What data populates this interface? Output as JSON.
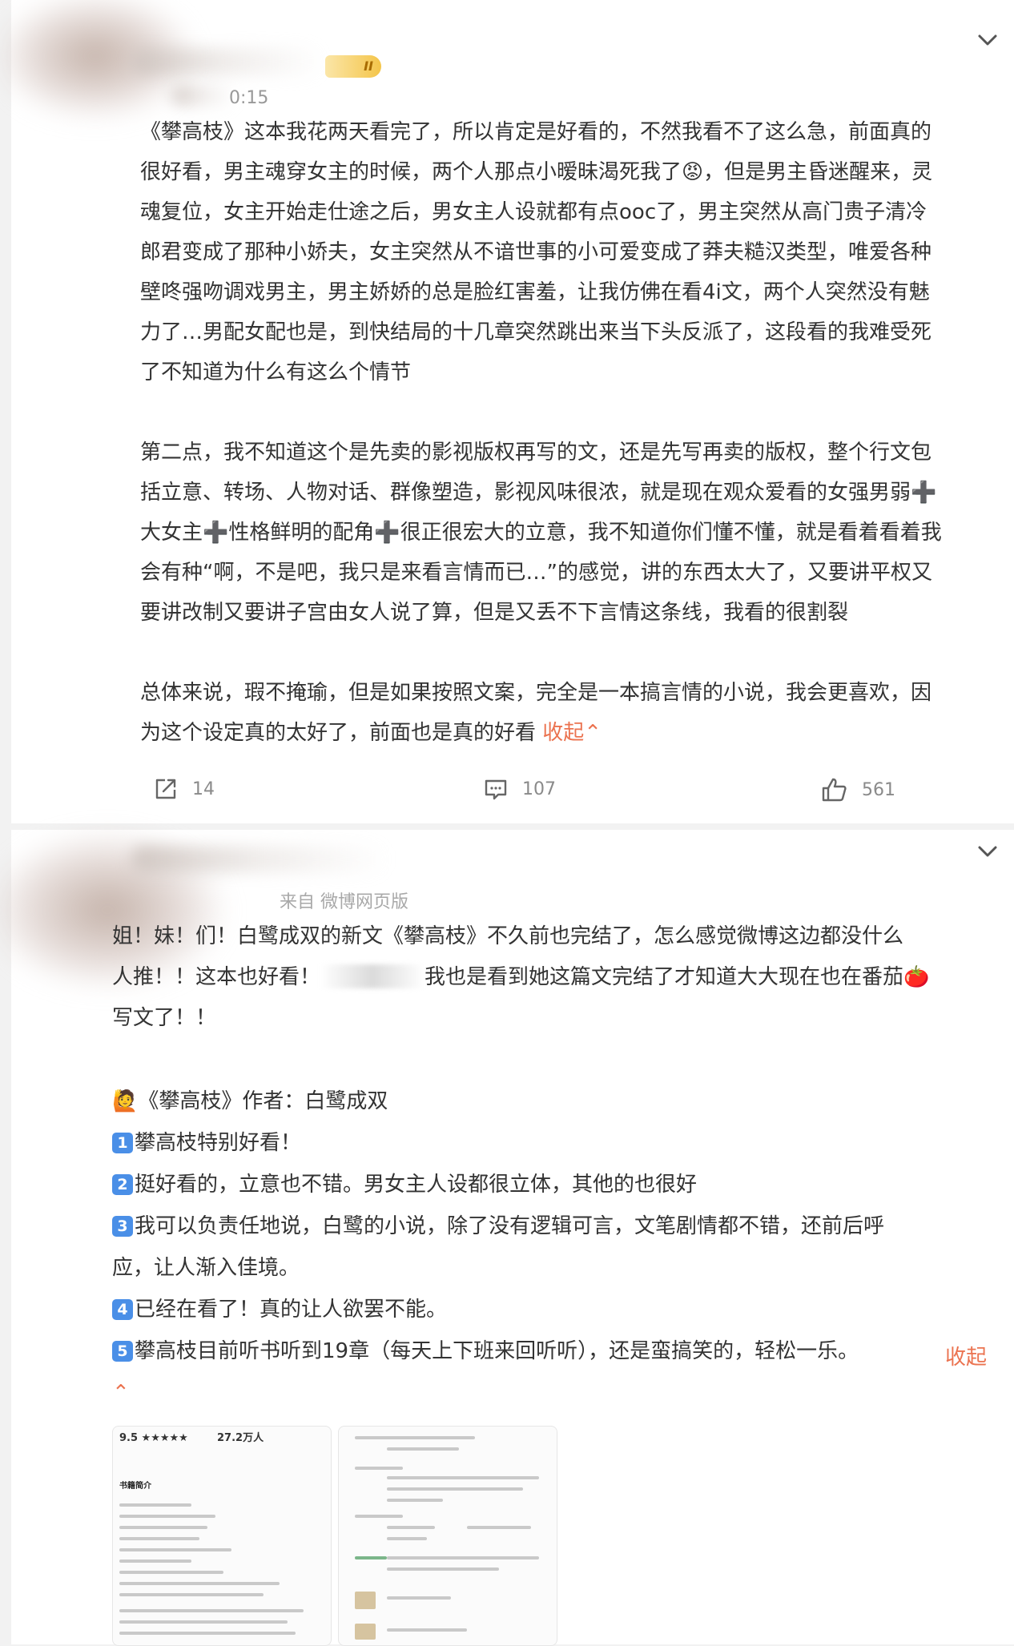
{
  "post1": {
    "time_suffix": "0:15",
    "badge_label": "II",
    "paragraphs": [
      [
        "《攀高枝》这本我花两天看完了，所以肯定是好看的，不然我看不了这么急，前面真的",
        "很好看，男主魂穿女主的时候，两个人那点小暧昧渴死我了😡，但是男主昏迷醒来，灵",
        "魂复位，女主开始走仕途之后，男女主人设就都有点ooc了，男主突然从高门贵子清冷",
        "郎君变成了那种小娇夫，女主突然从不谙世事的小可爱变成了莽夫糙汉类型，唯爱各种",
        "壁咚强吻调戏男主，男主娇娇的总是脸红害羞，让我仿佛在看4i文，两个人突然没有魅",
        "力了…男配女配也是，到快结局的十几章突然跳出来当下头反派了，这段看的我难受死",
        "了不知道为什么有这么个情节"
      ],
      [
        "第二点，我不知道这个是先卖的影视版权再写的文，还是先写再卖的版权，整个行文包",
        "括立意、转场、人物对话、群像塑造，影视风味很浓，就是现在观众爱看的女强男弱➕",
        "大女主➕性格鲜明的配角➕很正很宏大的立意，我不知道你们懂不懂，就是看着看着我",
        "会有种“啊，不是吧，我只是来看言情而已…”的感觉，讲的东西太大了，又要讲平权又",
        "要讲改制又要讲子宫由女人说了算，但是又丢不下言情这条线，我看的很割裂"
      ]
    ],
    "last_para_line1": "总体来说，瑕不掩瑜，但是如果按照文案，完全是一本搞言情的小说，我会更喜欢，因",
    "last_para_line2": "为这个设定真的太好了，前面也是真的好看",
    "collapse_label": "收起",
    "collapse_caret": "⌃",
    "share_count": "14",
    "comment_count": "107",
    "like_count": "561"
  },
  "post2": {
    "source_label": "来自 微博网页版",
    "intro_line1": "姐！妹！们！白鹭成双的新文《攀高枝》不久前也完结了，怎么感觉微博这边都没什么",
    "intro_line2a": "人推！！这本也好看！",
    "intro_line2b": "我也是看到她这篇文完结了才知道大大现在也在番茄🍅",
    "intro_line3": "写文了！！",
    "book_line": "《攀高枝》作者：白鹭成双",
    "book_emoji": "🙋",
    "items": [
      {
        "num": "1",
        "text": "攀高枝特别好看！"
      },
      {
        "num": "2",
        "text": "挺好看的，立意也不错。男女主人设都很立体，其他的也很好"
      },
      {
        "num": "3",
        "text": "我可以负责任地说，白鹭的小说，除了没有逻辑可言，文笔剧情都不错，还前后呼"
      },
      {
        "num": "",
        "text": "应，让人渐入佳境。"
      },
      {
        "num": "4",
        "text": "已经在看了！真的让人欲罢不能。"
      },
      {
        "num": "5",
        "text": "攀高枝目前听书听到19章（每天上下班来回听听），还是蛮搞笑的，轻松一乐。"
      }
    ],
    "collapse_label": "收起",
    "collapse_caret": "⌃",
    "thumb1": {
      "rating": "9.5 ★★★★★",
      "count": "27.2万人",
      "section": "书籍简介"
    }
  }
}
